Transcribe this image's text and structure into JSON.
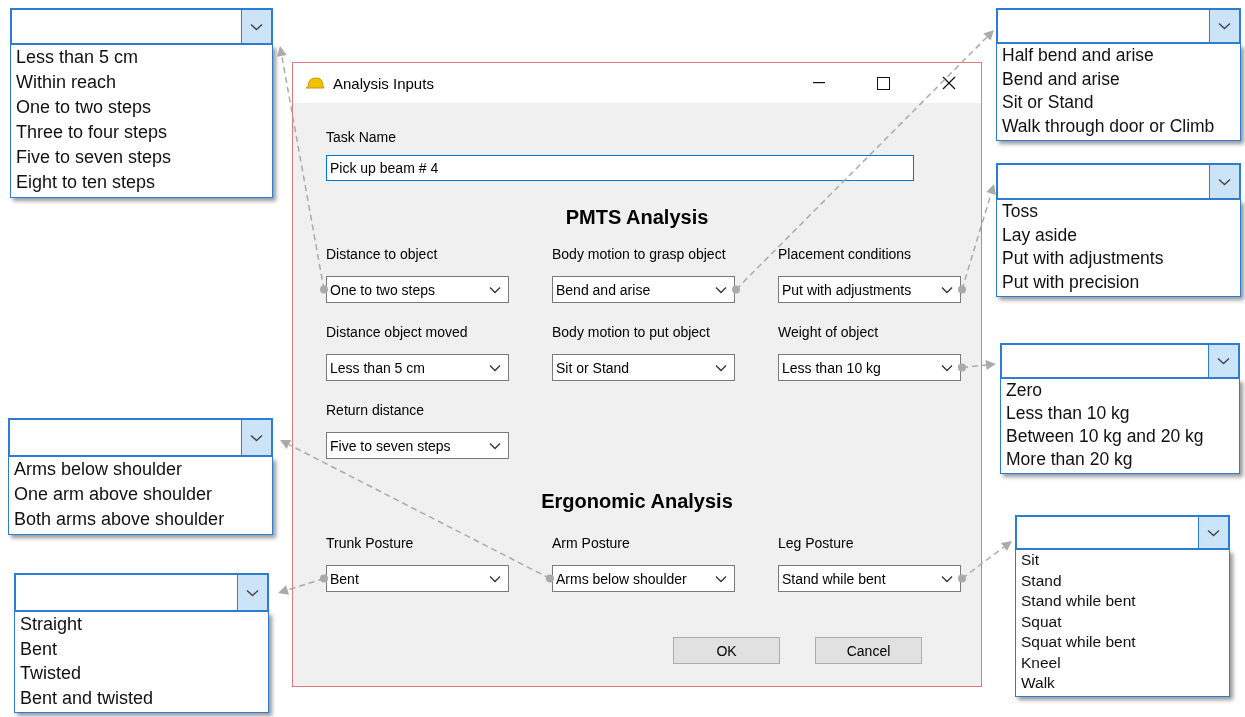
{
  "window": {
    "title": "Analysis Inputs"
  },
  "task_name": {
    "label": "Task Name",
    "value": "Pick up beam # 4"
  },
  "pmts": {
    "heading": "PMTS Analysis",
    "fields": [
      {
        "label": "Distance to object",
        "value": "One to two steps",
        "options": [
          "Less than 5 cm",
          "Within reach",
          "One to two steps",
          "Three to four steps",
          "Five to seven steps",
          "Eight to ten steps"
        ]
      },
      {
        "label": "Body motion to grasp object",
        "value": "Bend and arise",
        "options": [
          "Half bend and arise",
          "Bend and arise",
          "Sit or Stand",
          "Walk through door or Climb"
        ]
      },
      {
        "label": "Placement conditions",
        "value": "Put with adjustments",
        "options": [
          "Toss",
          "Lay aside",
          "Put with adjustments",
          "Put with precision"
        ]
      },
      {
        "label": "Distance object moved",
        "value": "Less than 5 cm"
      },
      {
        "label": "Body motion to put object",
        "value": "Sit or Stand"
      },
      {
        "label": "Weight of object",
        "value": "Less than 10 kg",
        "options": [
          "Zero",
          "Less than 10 kg",
          "Between 10 kg and 20 kg",
          "More than 20 kg"
        ]
      },
      {
        "label": "Return distance",
        "value": "Five to seven steps"
      }
    ]
  },
  "ergonomic": {
    "heading": "Ergonomic Analysis",
    "fields": [
      {
        "label": "Trunk Posture",
        "value": "Bent",
        "options": [
          "Straight",
          "Bent",
          "Twisted",
          "Bent and twisted"
        ]
      },
      {
        "label": "Arm Posture",
        "value": "Arms below shoulder",
        "options": [
          "Arms below shoulder",
          "One arm above shoulder",
          "Both arms above shoulder"
        ]
      },
      {
        "label": "Leg Posture",
        "value": "Stand while bent",
        "options": [
          "Sit",
          "Stand",
          "Stand while bent",
          "Squat",
          "Squat while bent",
          "Kneel",
          "Walk"
        ]
      }
    ]
  },
  "buttons": [
    "OK",
    "Cancel"
  ]
}
